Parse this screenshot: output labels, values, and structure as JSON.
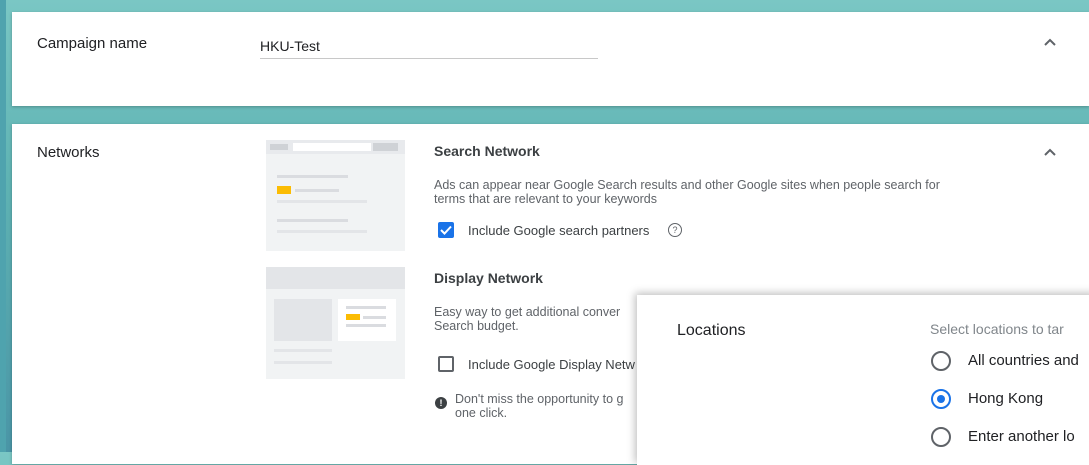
{
  "campaign": {
    "label": "Campaign name",
    "value": "HKU-Test"
  },
  "networks": {
    "label": "Networks",
    "search": {
      "title": "Search Network",
      "description_line1": "Ads can appear near Google Search results and other Google sites when people search for",
      "description_line2": "terms that are relevant to your keywords",
      "checkbox_label": "Include Google search partners",
      "checked": true
    },
    "display": {
      "title": "Display Network",
      "description_line1": "Easy way to get additional conver",
      "description_line2": "Search budget.",
      "checkbox_label": "Include Google Display Netw",
      "checked": false,
      "warning_line1": "Don't miss the opportunity to g",
      "warning_line2": "one click."
    }
  },
  "locations": {
    "label": "Locations",
    "hint": "Select locations to tar",
    "options": [
      {
        "label": "All countries and",
        "selected": false
      },
      {
        "label": "Hong Kong",
        "selected": true
      },
      {
        "label": "Enter another lo",
        "selected": false
      }
    ]
  },
  "colors": {
    "accent": "#1a73e8",
    "highlight": "#fbbc04",
    "background": "#5fb3b3"
  }
}
